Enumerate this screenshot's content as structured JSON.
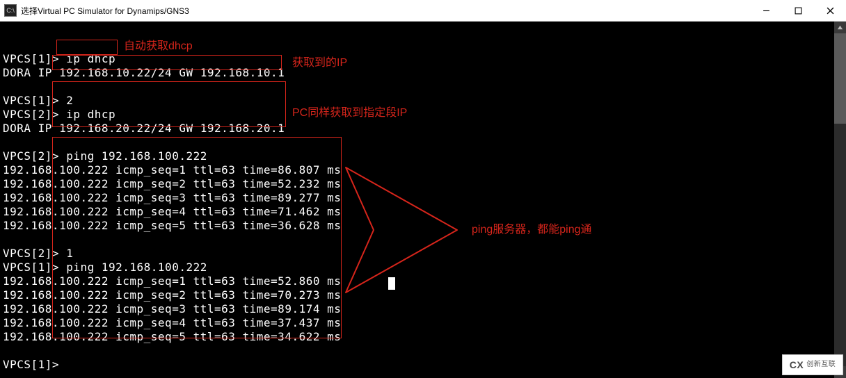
{
  "window": {
    "title": "选择Virtual PC Simulator for Dynamips/GNS3",
    "icon_label": "cmd-icon"
  },
  "terminal": {
    "lines": [
      "",
      "VPCS[1]> ip dhcp",
      "DORA IP 192.168.10.22/24 GW 192.168.10.1",
      "",
      "VPCS[1]> 2",
      "VPCS[2]> ip dhcp",
      "DORA IP 192.168.20.22/24 GW 192.168.20.1",
      "",
      "VPCS[2]> ping 192.168.100.222",
      "192.168.100.222 icmp_seq=1 ttl=63 time=86.807 ms",
      "192.168.100.222 icmp_seq=2 ttl=63 time=52.232 ms",
      "192.168.100.222 icmp_seq=3 ttl=63 time=89.277 ms",
      "192.168.100.222 icmp_seq=4 ttl=63 time=71.462 ms",
      "192.168.100.222 icmp_seq=5 ttl=63 time=36.628 ms",
      "",
      "VPCS[2]> 1",
      "VPCS[1]> ping 192.168.100.222",
      "192.168.100.222 icmp_seq=1 ttl=63 time=52.860 ms",
      "192.168.100.222 icmp_seq=2 ttl=63 time=70.273 ms",
      "192.168.100.222 icmp_seq=3 ttl=63 time=89.174 ms",
      "192.168.100.222 icmp_seq=4 ttl=63 time=37.437 ms",
      "192.168.100.222 icmp_seq=5 ttl=63 time=34.622 ms",
      "",
      "VPCS[1]>"
    ]
  },
  "annotations": {
    "note1": "自动获取dhcp",
    "note2": "获取到的IP",
    "note3": "PC同样获取到指定段IP",
    "note4": "ping服务器，都能ping通"
  },
  "watermark": {
    "text": "创新互联"
  }
}
